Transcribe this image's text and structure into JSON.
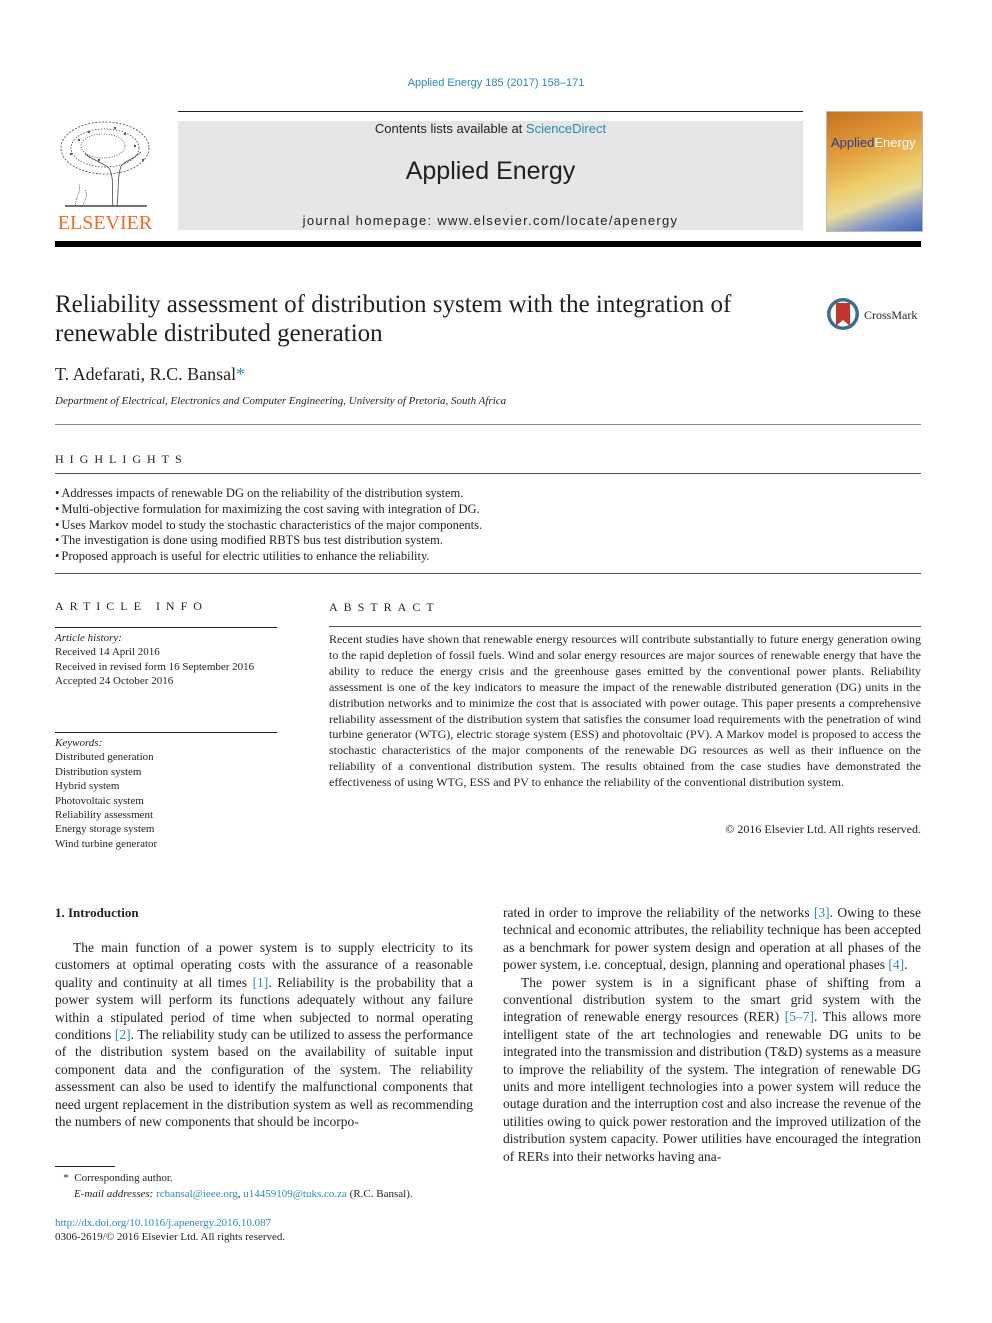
{
  "header": {
    "journal_ref": "Applied Energy 185 (2017) 158–171",
    "contents_prefix": "Contents lists available at ",
    "contents_link": "ScienceDirect",
    "journal_name": "Applied Energy",
    "homepage_label": "journal homepage: www.elsevier.com/locate/apenergy",
    "publisher_logo_text": "ELSEVIER",
    "cover_title_part1": "Applied",
    "cover_title_part2": "Energy",
    "crossmark_label": "CrossMark"
  },
  "article": {
    "title": "Reliability assessment of distribution system with the integration of renewable distributed generation",
    "authors": "T. Adefarati, R.C. Bansal",
    "corresponding_marker": "*",
    "affiliation": "Department of Electrical, Electronics and Computer Engineering, University of Pretoria, South Africa"
  },
  "highlights": {
    "heading": "HIGHLIGHTS",
    "items": [
      "Addresses impacts of renewable DG on the reliability of the distribution system.",
      "Multi-objective formulation for maximizing the cost saving with integration of DG.",
      "Uses Markov model to study the stochastic characteristics of the major components.",
      "The investigation is done using modified RBTS bus test distribution system.",
      "Proposed approach is useful for electric utilities to enhance the reliability."
    ]
  },
  "article_info": {
    "heading": "ARTICLE INFO",
    "history_label": "Article history:",
    "history": [
      "Received 14 April 2016",
      "Received in revised form 16 September 2016",
      "Accepted 24 October 2016"
    ],
    "keywords_label": "Keywords:",
    "keywords": [
      "Distributed generation",
      "Distribution system",
      "Hybrid system",
      "Photovoltaic system",
      "Reliability assessment",
      "Energy storage system",
      "Wind turbine generator"
    ]
  },
  "abstract": {
    "heading": "ABSTRACT",
    "text": "Recent studies have shown that renewable energy resources will contribute substantially to future energy generation owing to the rapid depletion of fossil fuels. Wind and solar energy resources are major sources of renewable energy that have the ability to reduce the energy crisis and the greenhouse gases emitted by the conventional power plants. Reliability assessment is one of the key indicators to measure the impact of the renewable distributed generation (DG) units in the distribution networks and to min­imize the cost that is associated with power outage. This paper presents a comprehensive reliability assessment of the distribution system that satisfies the consumer load requirements with the penetration of wind turbine generator (WTG), electric storage system (ESS) and photovoltaic (PV). A Markov model is proposed to access the stochastic characteristics of the major components of the renewable DG resources as well as their influence on the reliability of a conventional distribution system. The results obtained from the case studies have demonstrated the effectiveness of using WTG, ESS and PV to enhance the reli­ability of the conventional distribution system.",
    "copyright": "© 2016 Elsevier Ltd. All rights reserved."
  },
  "introduction": {
    "heading": "1. Introduction",
    "left_para_1a": "The main function of a power system is to supply electricity to its customers at optimal operating costs with the assurance of a reasonable quality and continuity at all times ",
    "ref_1": "[1]",
    "left_para_1b": ". Reliability is the probability that a power system will perform its functions ade­quately without any failure within a stipulated period of time when subjected to normal operating conditions ",
    "ref_2": "[2]",
    "left_para_1c": ". The reliability study can be utilized to assess the performance of the distribution system based on the availability of suitable input component data and the configuration of the system. The reliability assessment can also be used to identify the malfunctional components that need urgent replacement in the distribution system as well as recom­mending the numbers of new components that should be incorpo-",
    "right_para_1a": "rated in order to improve the reliability of the networks ",
    "ref_3": "[3]",
    "right_para_1b": ". Owing to these technical and economic attributes, the reliability tech­nique has been accepted as a benchmark for power system design and operation at all phases of the power system, i.e. conceptual, design, planning and operational phases ",
    "ref_4": "[4]",
    "right_para_1c": ".",
    "right_para_2a": "The power system is in a significant phase of shifting from a conventional distribution system to the smart grid system with the integration of renewable energy resources (RER) ",
    "ref_5_7": "[5–7]",
    "right_para_2b": ". This allows more intelligent state of the art technologies and renewable DG units to be integrated into the transmission and distribution (T&D) systems as a measure to improve the reliability of the sys­tem. The integration of renewable DG units and more intelligent technologies into a power system will reduce the outage duration and the interruption cost and also increase the revenue of the util­ities owing to quick power restoration and the improved utiliza­tion of the distribution system capacity. Power utilities have encouraged the integration of RERs into their networks having ana-"
  },
  "footnotes": {
    "marker": "*",
    "corresponding": "Corresponding author.",
    "email_label": "E-mail addresses:",
    "email_1": "rcbansal@ieee.org",
    "separator": ", ",
    "email_2": "u14459109@tuks.co.za",
    "email_suffix": " (R.C. Bansal).",
    "doi": "http://dx.doi.org/10.1016/j.apenergy.2016.10.087",
    "issn": "0306-2619/© 2016 Elsevier Ltd. All rights reserved."
  },
  "colors": {
    "link": "#2a8ab4",
    "elsevier_orange": "#f26d21",
    "banner_gray": "#e6e6e6"
  }
}
